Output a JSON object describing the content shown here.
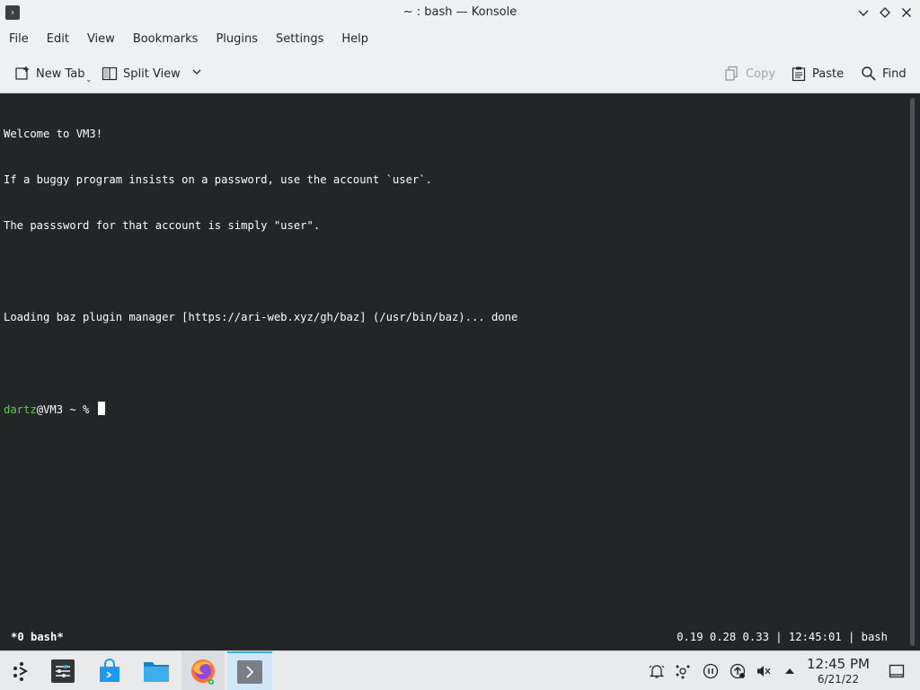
{
  "window": {
    "title": "~ : bash — Konsole",
    "app_icon_glyph": "›"
  },
  "menubar": {
    "items": [
      "File",
      "Edit",
      "View",
      "Bookmarks",
      "Plugins",
      "Settings",
      "Help"
    ]
  },
  "toolbar": {
    "new_tab": "New Tab",
    "split_view": "Split View",
    "copy": "Copy",
    "paste": "Paste",
    "find": "Find"
  },
  "terminal": {
    "lines": [
      "Welcome to VM3!",
      "If a buggy program insists on a password, use the account `user`.",
      "The passsword for that account is simply \"user\".",
      "",
      "Loading baz plugin manager [https://ari-web.xyz/gh/baz] (/usr/bin/baz)... done",
      ""
    ],
    "prompt_user": "dartz",
    "prompt_rest": "@VM3 ~ % ",
    "colors": {
      "background": "#232627",
      "foreground": "#fcfcfc",
      "prompt_user": "#4fd33f"
    }
  },
  "status": {
    "left": "*0 bash*",
    "right": "0.19 0.28 0.33 | 12:45:01 | bash"
  },
  "taskbar": {
    "apps": [
      "application-launcher-icon",
      "system-settings-icon",
      "discover-icon",
      "file-manager-icon",
      "firefox-icon",
      "konsole-icon"
    ],
    "tray": [
      "notifications-icon",
      "kde-connect-icon",
      "media-pause-icon",
      "updates-icon",
      "volume-muted-icon",
      "tray-expand-icon"
    ],
    "clock_time": "12:45 PM",
    "clock_date": "6/21/22",
    "accent": "#3daee9"
  }
}
